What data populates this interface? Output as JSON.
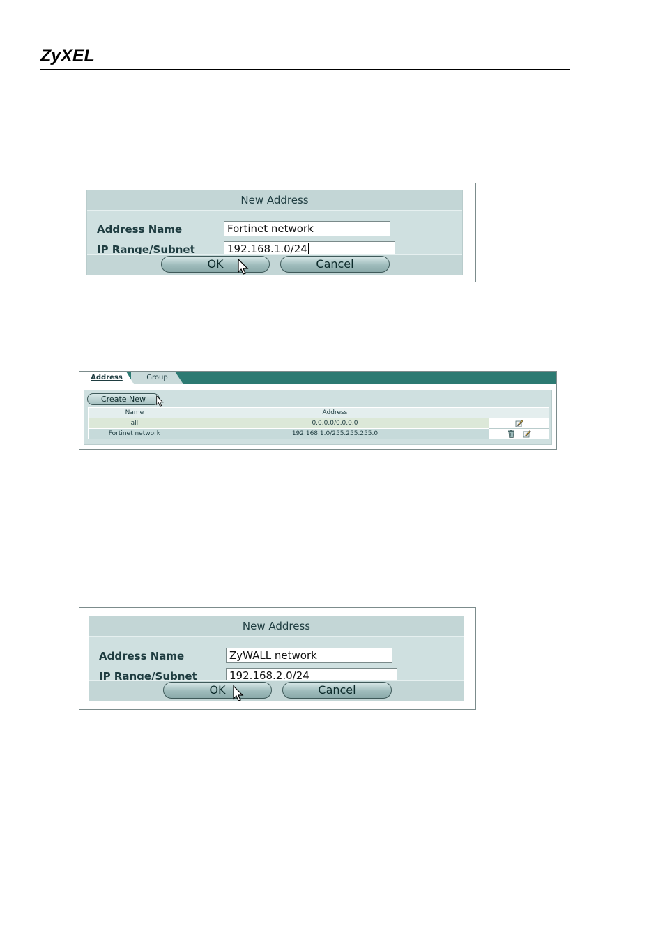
{
  "header": {
    "logo": "ZyXEL"
  },
  "dialog1": {
    "title": "New Address",
    "address_name_label": "Address Name",
    "address_name_value": "Fortinet network",
    "ip_label": "IP Range/Subnet",
    "ip_value": "192.168.1.0/24",
    "ok_label": "OK",
    "cancel_label": "Cancel"
  },
  "address_list": {
    "tabs": [
      "Address",
      "Group"
    ],
    "create_new_label": "Create New",
    "columns": [
      "Name",
      "Address",
      ""
    ],
    "rows": [
      {
        "name": "all",
        "address": "0.0.0.0/0.0.0.0",
        "actions": [
          "edit-icon"
        ]
      },
      {
        "name": "Fortinet network",
        "address": "192.168.1.0/255.255.255.0",
        "actions": [
          "delete-icon",
          "edit-icon"
        ]
      }
    ]
  },
  "dialog2": {
    "title": "New Address",
    "address_name_label": "Address Name",
    "address_name_value": "ZyWALL network",
    "ip_label": "IP Range/Subnet",
    "ip_value": "192.168.2.0/24",
    "ok_label": "OK",
    "cancel_label": "Cancel"
  }
}
